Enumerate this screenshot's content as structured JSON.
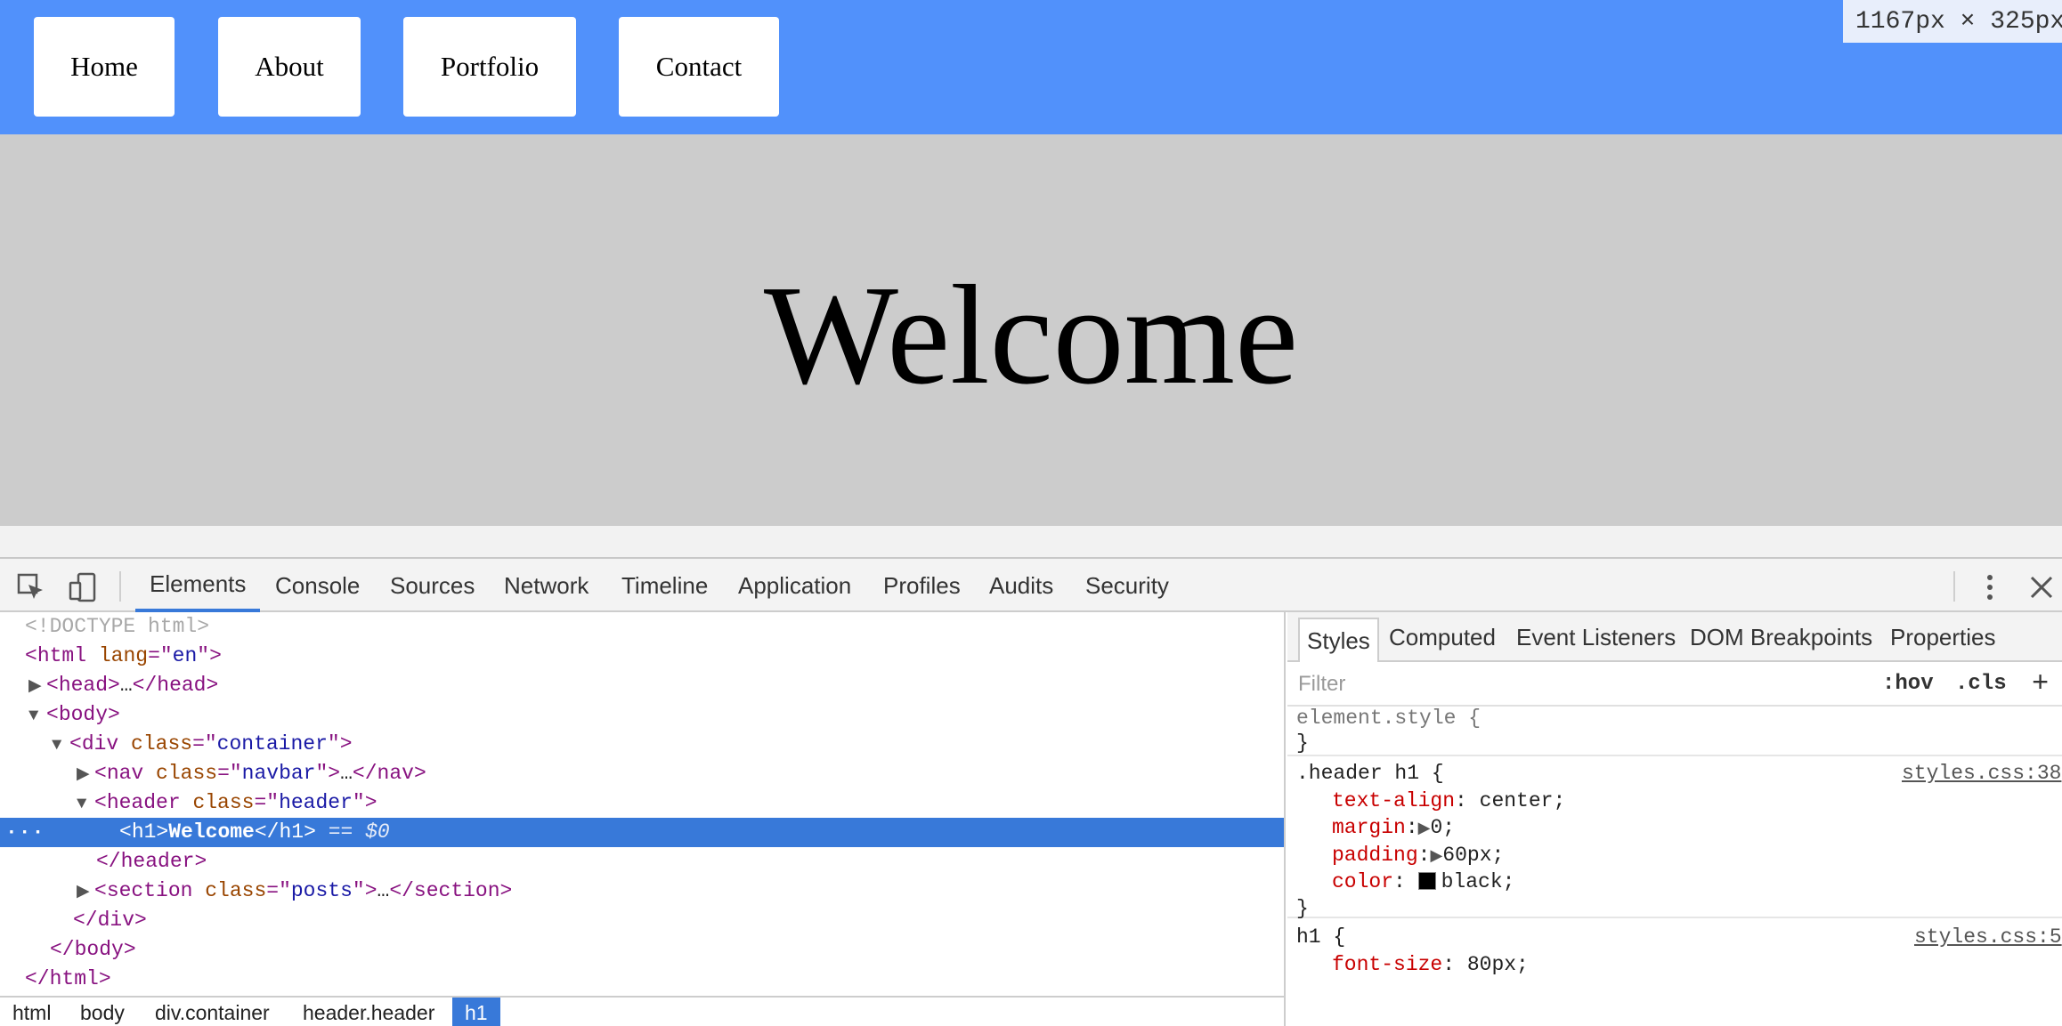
{
  "page": {
    "nav_links": [
      "Home",
      "About",
      "Portfolio",
      "Contact"
    ],
    "hero_title": "Welcome",
    "size_badge": "1167px × 325px"
  },
  "devtools": {
    "tabs": [
      "Elements",
      "Console",
      "Sources",
      "Network",
      "Timeline",
      "Application",
      "Profiles",
      "Audits",
      "Security"
    ],
    "active_tab": "Elements",
    "dom": {
      "doctype": "<!DOCTYPE html>",
      "html_open": "html",
      "lang_attr": "lang",
      "lang_val": "en",
      "head": "head",
      "ellipsis": "…",
      "body": "body",
      "div": "div",
      "class_attr": "class",
      "container_val": "container",
      "nav": "nav",
      "navbar_val": "navbar",
      "header": "header",
      "header_val": "header",
      "h1": "h1",
      "h1_text": "Welcome",
      "selected_marker": "== $0",
      "section": "section",
      "posts_val": "posts"
    },
    "breadcrumbs": [
      "html",
      "body",
      "div.container",
      "header.header",
      "h1"
    ],
    "styles_tabs": [
      "Styles",
      "Computed",
      "Event Listeners",
      "DOM Breakpoints",
      "Properties"
    ],
    "filter_placeholder": "Filter",
    "hov": ":hov",
    "cls": ".cls",
    "add": "+",
    "rules": {
      "element_style": "element.style {",
      "close": "}",
      "header_h1_selector": ".header h1 {",
      "header_h1_source": "styles.css:38",
      "text_align_prop": "text-align",
      "text_align_val": "center;",
      "margin_prop": "margin",
      "margin_val": "0;",
      "padding_prop": "padding",
      "padding_val": "60px;",
      "color_prop": "color",
      "color_val": "black;",
      "h1_selector": "h1 {",
      "h1_source": "styles.css:5",
      "font_size_prop": "font-size",
      "font_size_val": "80px;"
    }
  }
}
